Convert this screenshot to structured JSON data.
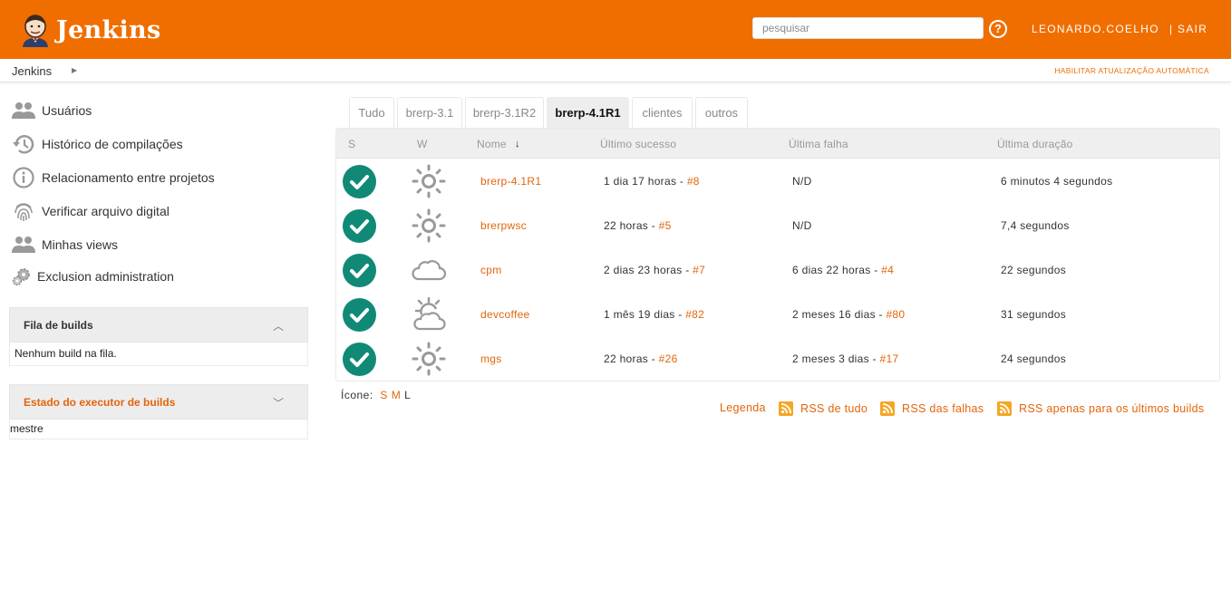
{
  "header": {
    "logo_text": "Jenkins",
    "search_placeholder": "pesquisar",
    "help_label": "?",
    "user": "LEONARDO.COELHO",
    "logout": "| SAIR",
    "brand_color": "#f06e00"
  },
  "breadcrumb": {
    "root": "Jenkins",
    "auto_refresh": "HABILITAR ATUALIZAÇÃO AUTOMÁTICA"
  },
  "sidebar": {
    "tasks": [
      {
        "label": "Usuários",
        "icon": "people-icon"
      },
      {
        "label": "Histórico de compilações",
        "icon": "history-icon"
      },
      {
        "label": "Relacionamento entre projetos",
        "icon": "info-icon"
      },
      {
        "label": "Verificar arquivo digital",
        "icon": "fingerprint-icon"
      },
      {
        "label": "Minhas views",
        "icon": "people-icon"
      },
      {
        "label": "Exclusion administration",
        "icon": "gears-icon"
      }
    ],
    "build_queue": {
      "title": "Fila de builds",
      "empty": "Nenhum build na fila."
    },
    "executors": {
      "title": "Estado do executor de builds",
      "node": "mestre"
    }
  },
  "tabs": [
    {
      "label": "Tudo",
      "active": false
    },
    {
      "label": "brerp-3.1",
      "active": false
    },
    {
      "label": "brerp-3.1R2",
      "active": false
    },
    {
      "label": "brerp-4.1R1",
      "active": true
    },
    {
      "label": "clientes",
      "active": false
    },
    {
      "label": "outros",
      "active": false
    }
  ],
  "table": {
    "headers": {
      "s": "S",
      "w": "W",
      "name": "Nome",
      "sort_arrow": "↓",
      "last_success": "Último sucesso",
      "last_failure": "Última falha",
      "last_duration": "Última duração"
    },
    "rows": [
      {
        "status": "success",
        "weather": "sunny-icon",
        "name": "brerp-4.1R1",
        "success_time": "1 dia 17 horas -",
        "success_build": "#8",
        "failure_time": "N/D",
        "failure_build": "",
        "duration": "6 minutos 4 segundos"
      },
      {
        "status": "success",
        "weather": "sunny-icon",
        "name": "brerpwsc",
        "success_time": "22 horas -",
        "success_build": "#5",
        "failure_time": "N/D",
        "failure_build": "",
        "duration": "7,4 segundos"
      },
      {
        "status": "success",
        "weather": "cloudy-icon",
        "name": "cpm",
        "success_time": "2 dias 23 horas -",
        "success_build": "#7",
        "failure_time": "6 dias 22 horas -",
        "failure_build": "#4",
        "duration": "22 segundos"
      },
      {
        "status": "success",
        "weather": "partly-cloudy-icon",
        "name": "devcoffee",
        "success_time": "1 mês 19 dias -",
        "success_build": "#82",
        "failure_time": "2 meses 16 dias -",
        "failure_build": "#80",
        "duration": "31 segundos"
      },
      {
        "status": "success",
        "weather": "sunny-icon",
        "name": "mgs",
        "success_time": "22 horas -",
        "success_build": "#26",
        "failure_time": "2 meses 3 dias -",
        "failure_build": "#17",
        "duration": "24 segundos"
      }
    ]
  },
  "footer": {
    "icon_label": "Ícone:",
    "sizes": [
      "S",
      "M",
      "L"
    ],
    "legend": "Legenda",
    "rss_all": "RSS de tudo",
    "rss_failures": "RSS das falhas",
    "rss_latest": "RSS apenas para os últimos builds"
  },
  "colors": {
    "success": "#108a77",
    "link": "#e2650a",
    "rss": "#f5a623"
  }
}
